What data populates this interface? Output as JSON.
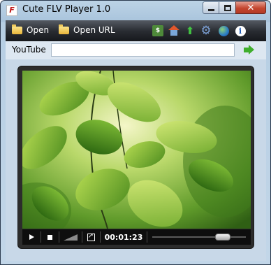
{
  "window": {
    "title": "Cute FLV Player 1.0",
    "close_glyph": "✕"
  },
  "toolbar": {
    "open_label": "Open",
    "open_url_label": "Open URL",
    "icons": [
      "money-icon",
      "home-icon",
      "upload-arrow-icon",
      "gear-icon",
      "globe-icon",
      "info-icon"
    ],
    "info_glyph": "i",
    "gear_glyph": "⚙",
    "up_glyph": "⬆",
    "money_glyph": "$"
  },
  "youtube": {
    "label": "YouTube",
    "url_value": "",
    "placeholder": ""
  },
  "controls": {
    "time": "00:01:23",
    "seek_position": 0.8
  },
  "colors": {
    "toolbar_dark": "#16181c",
    "close_red": "#c4452e",
    "accent_green": "#3fae2c",
    "stage_bg": "#2c2c2c"
  }
}
